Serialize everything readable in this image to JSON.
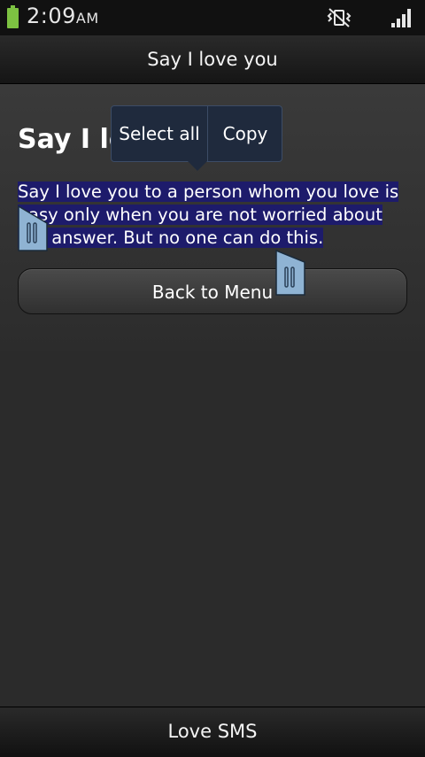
{
  "status_bar": {
    "time": "2:09",
    "ampm": "AM",
    "battery_icon": "battery-icon",
    "mute_icon": "mute-vibrate-icon",
    "signal_icon": "signal-icon",
    "battery_color": "#7dc242"
  },
  "title_bar": {
    "title": "Say I love you"
  },
  "content": {
    "heading": "Say I love you",
    "body": "Say I love you to a person whom you love is easy only when you are not worried about the answer. But no one can do this.",
    "selection_color": "#1d1b6b"
  },
  "popup": {
    "select_all": "Select all",
    "copy": "Copy"
  },
  "button": {
    "back_label": "Back to Menu"
  },
  "bottom_bar": {
    "label": "Love SMS"
  }
}
